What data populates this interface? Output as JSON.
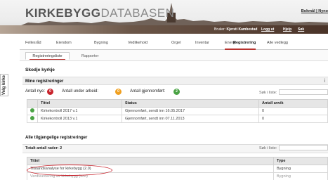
{
  "header": {
    "logo_bold": "KIRKEBYGG",
    "logo_light": "DATABASEN",
    "top_link": "Bokmål | Nyno",
    "user_label": "Bruker:",
    "user_name": "Kjersti Kambestad",
    "links": [
      "Logg ut",
      "Hjelp",
      "Søk"
    ]
  },
  "nav": {
    "tabs": [
      "Fellesråd",
      "Eiendom",
      "Bygning",
      "Vedlikehold",
      "Orgel",
      "Inventar",
      "Energi",
      "Registrering",
      "Alle vedlegg"
    ],
    "active": "Registrering"
  },
  "subnav": {
    "tabs": [
      "Registreringsliste",
      "Rapporter"
    ],
    "active": "Registreringsliste"
  },
  "side_tab": "Velg kirke",
  "church_title": "Skodje kyrkje",
  "my_regs": {
    "title": "Mine registreringer",
    "info_icon": "i",
    "counts": [
      {
        "label": "Antall nye:",
        "value": "0",
        "color": "#c8232c"
      },
      {
        "label": "Antall under arbeid:",
        "value": "0",
        "color": "#f0a020"
      },
      {
        "label": "Antall gjennomført:",
        "value": "2",
        "color": "#4aa344"
      }
    ],
    "search_label": "Søk i liste:",
    "columns": [
      "",
      "Tittel",
      "Status",
      "Antall avvik"
    ],
    "rows": [
      {
        "title": "Kirkekontroll 2017 v.1",
        "status": "Gjennomført, sendt inn 16.05.2017",
        "deviations": "0"
      },
      {
        "title": "Kirkekontroll 2013 v.1",
        "status": "Gjennomført, sendt inn 07.11.2013",
        "deviations": "0"
      }
    ]
  },
  "all_regs": {
    "title": "Alle tilgjengelige registreringer",
    "total": "Totalt antall rader: 2",
    "search_label": "Søk i liste:",
    "columns": [
      "Tittel",
      "Type"
    ],
    "rows": [
      {
        "title": "Tilstandsanalyse for kirkebygg (2.0)",
        "type": "Bygning"
      },
      {
        "title": "Verdivurdering av kirkebygg (test)",
        "type": "Bygning"
      }
    ]
  }
}
